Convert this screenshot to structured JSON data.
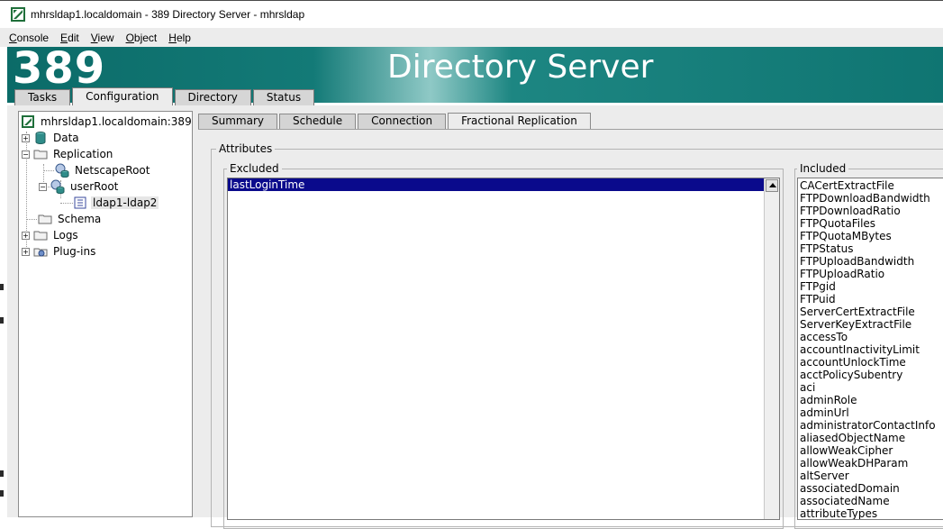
{
  "window": {
    "title": "mhrsldap1.localdomain - 389 Directory Server - mhrsldap"
  },
  "menu": [
    {
      "label": "Console",
      "key": "C",
      "rest": "onsole"
    },
    {
      "label": "Edit",
      "key": "E",
      "rest": "dit"
    },
    {
      "label": "View",
      "key": "V",
      "rest": "iew"
    },
    {
      "label": "Object",
      "key": "O",
      "rest": "bject"
    },
    {
      "label": "Help",
      "key": "H",
      "rest": "elp"
    }
  ],
  "banner": {
    "number": "389",
    "product": "Directory Server"
  },
  "main_tabs": [
    "Tasks",
    "Configuration",
    "Directory",
    "Status"
  ],
  "main_tab_active": "Configuration",
  "tree": {
    "root": "mhrsldap1.localdomain:389",
    "data": "Data",
    "replication": "Replication",
    "netscaperoot": "NetscapeRoot",
    "userroot": "userRoot",
    "agreement": "ldap1-ldap2",
    "schema": "Schema",
    "logs": "Logs",
    "plugins": "Plug-ins"
  },
  "sub_tabs": [
    "Summary",
    "Schedule",
    "Connection",
    "Fractional Replication"
  ],
  "sub_tab_active": "Fractional Replication",
  "attributes_group": "Attributes",
  "excluded": {
    "label": "Excluded",
    "items": [
      "lastLoginTime"
    ],
    "selected": "lastLoginTime"
  },
  "included": {
    "label": "Included",
    "items": [
      "CACertExtractFile",
      "FTPDownloadBandwidth",
      "FTPDownloadRatio",
      "FTPQuotaFiles",
      "FTPQuotaMBytes",
      "FTPStatus",
      "FTPUploadBandwidth",
      "FTPUploadRatio",
      "FTPgid",
      "FTPuid",
      "ServerCertExtractFile",
      "ServerKeyExtractFile",
      "accessTo",
      "accountInactivityLimit",
      "accountUnlockTime",
      "acctPolicySubentry",
      "aci",
      "adminRole",
      "adminUrl",
      "administratorContactInfo",
      "aliasedObjectName",
      "allowWeakCipher",
      "allowWeakDHParam",
      "altServer",
      "associatedDomain",
      "associatedName",
      "attributeTypes"
    ]
  },
  "colors": {
    "banner": "#137a77",
    "selection": "#0a0a8c"
  }
}
